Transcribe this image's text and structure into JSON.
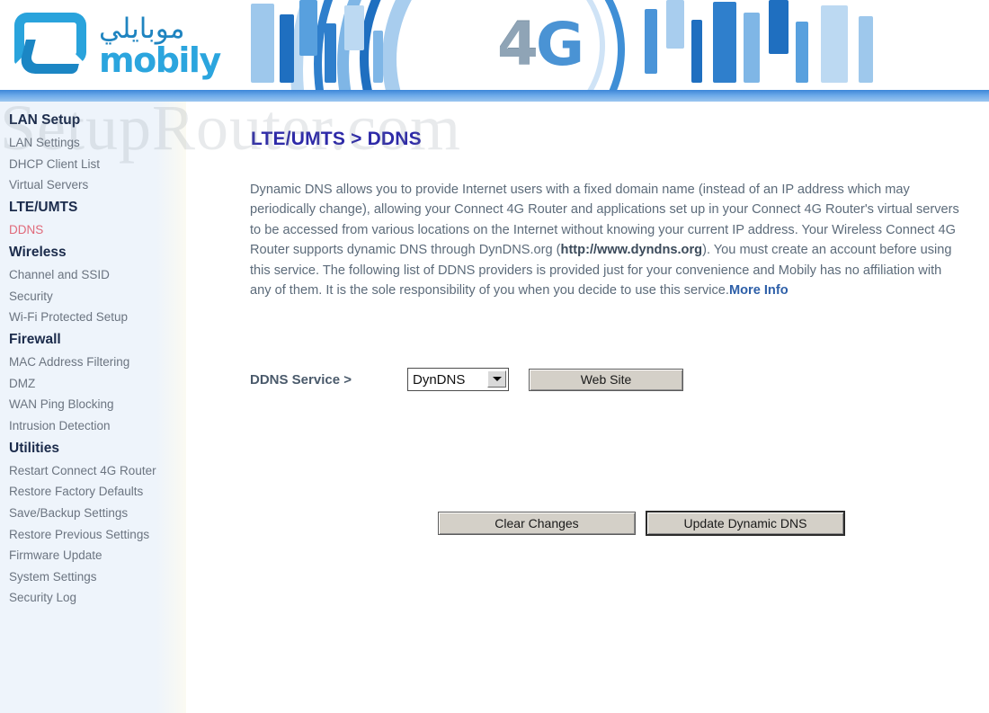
{
  "brand": {
    "logo_arabic": "موبايلي",
    "logo_latin": "mobily",
    "banner_text": "4G",
    "banner_4": "4",
    "banner_g": "G",
    "accent_blue": "#2ba5de",
    "bar_blue": "#6aa8e8"
  },
  "watermark": {
    "text": "SetupRouter.com"
  },
  "sidebar": {
    "groups": [
      {
        "heading": "LAN Setup",
        "items": [
          {
            "label": "LAN Settings",
            "active": false
          },
          {
            "label": "DHCP Client List",
            "active": false
          },
          {
            "label": "Virtual Servers",
            "active": false
          }
        ]
      },
      {
        "heading": "LTE/UMTS",
        "items": [
          {
            "label": "DDNS",
            "active": true
          }
        ]
      },
      {
        "heading": "Wireless",
        "items": [
          {
            "label": "Channel and SSID",
            "active": false
          },
          {
            "label": "Security",
            "active": false
          },
          {
            "label": "Wi-Fi Protected Setup",
            "active": false
          }
        ]
      },
      {
        "heading": "Firewall",
        "items": [
          {
            "label": "MAC Address Filtering",
            "active": false
          },
          {
            "label": "DMZ",
            "active": false
          },
          {
            "label": "WAN Ping Blocking",
            "active": false
          },
          {
            "label": "Intrusion Detection",
            "active": false
          }
        ]
      },
      {
        "heading": "Utilities",
        "items": [
          {
            "label": "Restart Connect 4G Router",
            "active": false
          },
          {
            "label": "Restore Factory Defaults",
            "active": false
          },
          {
            "label": "Save/Backup Settings",
            "active": false
          },
          {
            "label": "Restore Previous Settings",
            "active": false
          },
          {
            "label": "Firmware Update",
            "active": false
          },
          {
            "label": "System Settings",
            "active": false
          },
          {
            "label": "Security Log",
            "active": false
          }
        ]
      }
    ],
    "active_color": "#e0697a",
    "heading_color": "#1b2b4b",
    "item_color": "#6b7480"
  },
  "main": {
    "title": "LTE/UMTS > DDNS",
    "title_color": "#2e2aa8",
    "intro": {
      "part1": "Dynamic DNS allows you to provide Internet users with a fixed domain name (instead of an IP address which may periodically change), allowing your Connect 4G Router and applications set up in your Connect 4G Router's virtual servers to be accessed from various locations on the Internet without knowing your current IP address. Your Wireless Connect 4G Router supports dynamic DNS through DynDNS.org (",
      "link_url_text": "http://www.dyndns.org",
      "part2": "). You must create an account before using this service. The following list of DDNS providers is provided just for your convenience and Mobily has no affiliation with any of them. It is the sole responsibility of you when you decide to use this service.",
      "more_info": "More Info"
    },
    "form": {
      "ddns_service_label": "DDNS Service >",
      "ddns_service_value": "DynDNS",
      "ddns_service_options": [
        "DynDNS"
      ],
      "website_button": "Web Site"
    },
    "buttons": {
      "clear": "Clear Changes",
      "update": "Update Dynamic DNS"
    }
  }
}
